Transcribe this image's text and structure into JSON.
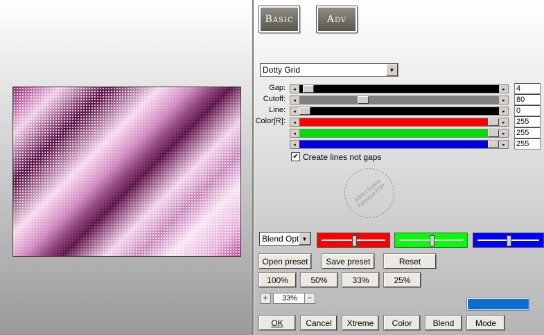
{
  "tabs": {
    "basic": "Basic",
    "adv": "Adv"
  },
  "filter_select": {
    "value": "Dotty Grid"
  },
  "sliders": [
    {
      "label": "Gap:",
      "value": "4",
      "level": 0.02,
      "color": "#000000"
    },
    {
      "label": "Cutoff:",
      "value": "80",
      "level": 0.31,
      "color": "#808080"
    },
    {
      "label": "Line:",
      "value": "0",
      "level": 0.0,
      "color": "#000000"
    },
    {
      "label": "Color[R]:",
      "value": "255",
      "level": 1.0,
      "color": "#ff0000"
    },
    {
      "label": "",
      "value": "255",
      "level": 1.0,
      "color": "#00e000"
    },
    {
      "label": "",
      "value": "255",
      "level": 1.0,
      "color": "#0000e0"
    }
  ],
  "checkbox": {
    "label": "Create lines not gaps",
    "checked": "✔"
  },
  "watermark": {
    "text": "Addict Estela Fonseca PSP"
  },
  "blend_select": {
    "value": "Blend Opti"
  },
  "blend_swatches": [
    {
      "color": "#ff0000",
      "level": 0.5
    },
    {
      "color": "#00ff00",
      "level": 0.5
    },
    {
      "color": "#0000ff",
      "level": 0.5
    }
  ],
  "preset_buttons": {
    "open": "Open preset",
    "save": "Save preset",
    "reset": "Reset"
  },
  "zoom_buttons": [
    "100%",
    "50%",
    "33%",
    "25%"
  ],
  "zoom": {
    "plus": "+",
    "value": "33%",
    "minus": "−"
  },
  "color_box": "#0a6fd0",
  "bottom_buttons": {
    "ok": "OK",
    "cancel": "Cancel",
    "xtreme": "Xtreme",
    "color": "Color",
    "blend": "Blend",
    "mode": "Mode"
  }
}
